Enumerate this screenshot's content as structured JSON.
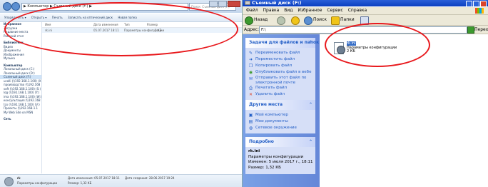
{
  "win7": {
    "address": "▶ Компьютер ▶ Съемный диск (F:) ▶",
    "search_placeholder": "Поиск: Съемный диск (F:)",
    "toolbar": [
      "Упорядочить ▾",
      "Открыть ▾",
      "Печать",
      "Записать на оптический диск",
      "Новая папка"
    ],
    "nav": [
      {
        "label": "Избранное",
        "header": true
      },
      {
        "label": "Загрузки"
      },
      {
        "label": "Недавние места"
      },
      {
        "label": "Рабочий стол"
      },
      {
        "gap": true
      },
      {
        "label": "Библиотеки",
        "header": true
      },
      {
        "label": "Видео"
      },
      {
        "label": "Документы"
      },
      {
        "label": "Изображения"
      },
      {
        "label": "Музыка"
      },
      {
        "gap": true
      },
      {
        "label": "Компьютер",
        "header": true
      },
      {
        "label": "Локальный диск (C:)"
      },
      {
        "label": "Локальный диск (D:)"
      },
      {
        "label": "Съемный диск (F:)",
        "selected": true
      },
      {
        "label": "ucolli (\\\\192.168.1.100) (X:)"
      },
      {
        "label": "производство (\\\\192.168"
      },
      {
        "label": "soft (\\\\192.168.1.100) (S:)"
      },
      {
        "label": "log (\\\\192.168.1.100) (Y:)"
      },
      {
        "label": "ima (\\\\192.168.1.100) (W:)"
      },
      {
        "label": "консультация (\\\\192.168"
      },
      {
        "label": "tcx (\\\\192.168.1.100) (V:)"
      },
      {
        "label": "Проекты (\\\\192.168.1.1"
      },
      {
        "label": "My Web Site on MSN"
      },
      {
        "gap": true
      },
      {
        "label": "Сеть",
        "header": true
      }
    ],
    "list": {
      "headers": [
        "Имя",
        "Дата изменения",
        "Тип",
        "Размер"
      ],
      "rows": [
        {
          "name": "rk.ini",
          "date": "05.07.2017 18:11",
          "type": "Параметры конфигурации",
          "size": "1 КБ"
        }
      ]
    },
    "details": {
      "name": "rk",
      "type": "Параметры конфигурации",
      "modified": "Дата изменения: 05.07.2017 18:11",
      "size": "Размер: 1,32 КБ",
      "created": "Дата создания: 28.06.2017 19:24"
    }
  },
  "xp": {
    "title": "Съемный диск (F:)",
    "menu": [
      "Файл",
      "Правка",
      "Вид",
      "Избранное",
      "Сервис",
      "Справка"
    ],
    "toolbar": {
      "back": "Назад",
      "search": "Поиск",
      "folders": "Папки"
    },
    "address_label": "Адрес:",
    "address_value": "F:\\",
    "go_label": "Переход",
    "tasks_panel": {
      "title": "Задачи для файлов и папок",
      "items": [
        {
          "icon": "rename-icon",
          "label": "Переименовать файл"
        },
        {
          "icon": "move-icon",
          "label": "Переместить файл"
        },
        {
          "icon": "copy-icon",
          "label": "Копировать файл"
        },
        {
          "icon": "web-publish-icon",
          "label": "Опубликовать файл в вебе"
        },
        {
          "icon": "email-icon",
          "label": "Отправить этот файл по электронной почте"
        },
        {
          "icon": "print-icon",
          "label": "Печатать файл"
        },
        {
          "icon": "delete-icon",
          "label": "Удалить файл"
        }
      ]
    },
    "places_panel": {
      "title": "Другие места",
      "items": [
        {
          "icon": "my-computer-icon",
          "label": "Мой компьютер"
        },
        {
          "icon": "my-documents-icon",
          "label": "Мои документы"
        },
        {
          "icon": "network-icon",
          "label": "Сетевое окружение"
        }
      ]
    },
    "details_panel": {
      "title": "Подробно",
      "name": "rk.ini",
      "type": "Параметры конфигурации",
      "modified": "Изменен: 5 июля 2017 г., 18:11",
      "size": "Размер: 1,32 КБ"
    },
    "file": {
      "name": "rk.ini",
      "type": "Параметры конфигурации",
      "size": "2 КБ"
    }
  },
  "colors": {
    "xp_title": "#0a3fbf",
    "xp_sidebar": "#7aa1e6",
    "annotation": "#e8181c"
  }
}
